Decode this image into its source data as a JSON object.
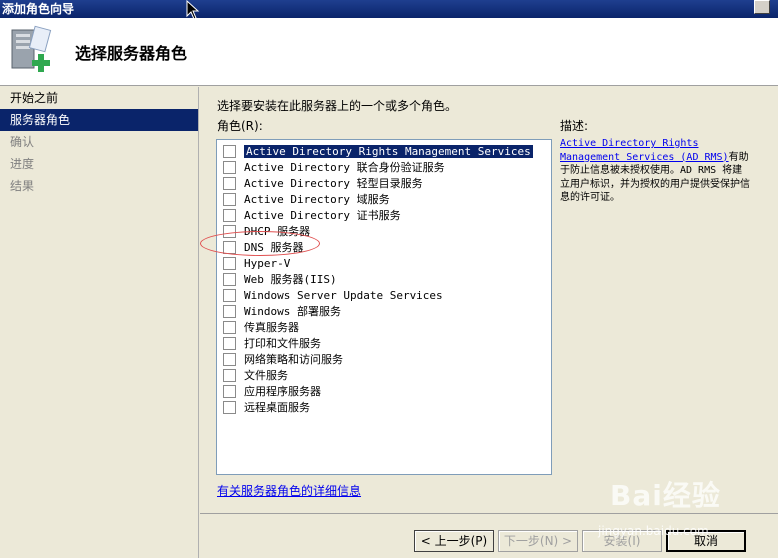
{
  "window": {
    "title": "添加角色向导"
  },
  "header": {
    "title": "选择服务器角色"
  },
  "nav": {
    "items": [
      {
        "label": "开始之前",
        "state": "done"
      },
      {
        "label": "服务器角色",
        "state": "active"
      },
      {
        "label": "确认",
        "state": "pending"
      },
      {
        "label": "进度",
        "state": "pending"
      },
      {
        "label": "结果",
        "state": "pending"
      }
    ]
  },
  "main": {
    "instruction": "选择要安装在此服务器上的一个或多个角色。",
    "roles_label": "角色(R):",
    "roles": [
      {
        "label": "Active Directory Rights Management Services",
        "checked": false,
        "selected": true
      },
      {
        "label": "Active Directory 联合身份验证服务",
        "checked": false
      },
      {
        "label": "Active Directory 轻型目录服务",
        "checked": false
      },
      {
        "label": "Active Directory 域服务",
        "checked": false
      },
      {
        "label": "Active Directory 证书服务",
        "checked": false
      },
      {
        "label": "DHCP 服务器",
        "checked": false
      },
      {
        "label": "DNS 服务器",
        "checked": false
      },
      {
        "label": "Hyper-V",
        "checked": false
      },
      {
        "label": "Web 服务器(IIS)",
        "checked": false
      },
      {
        "label": "Windows Server Update Services",
        "checked": false
      },
      {
        "label": "Windows 部署服务",
        "checked": false
      },
      {
        "label": "传真服务器",
        "checked": false
      },
      {
        "label": "打印和文件服务",
        "checked": false
      },
      {
        "label": "网络策略和访问服务",
        "checked": false
      },
      {
        "label": "文件服务",
        "checked": false
      },
      {
        "label": "应用程序服务器",
        "checked": false
      },
      {
        "label": "远程桌面服务",
        "checked": false
      }
    ],
    "description_label": "描述:",
    "description_link": "Active Directory Rights Management Services (AD RMS)",
    "description_text": "有助于防止信息被未授权使用。AD RMS 将建立用户标识，并为授权的用户提供受保护信息的许可证。",
    "more_info_link": "有关服务器角色的详细信息"
  },
  "footer": {
    "back_label": "< 上一步(P)",
    "next_label": "下一步(N) >",
    "install_label": "安装(I)",
    "cancel_label": "取消"
  },
  "watermark": {
    "brand": "Bai经验",
    "url": "jingyan.baidu.com"
  },
  "icons": {
    "header": "server-add-icon",
    "close": "close-icon"
  },
  "colors": {
    "title_bar": "#0a246a",
    "selection": "#0a246a",
    "link": "#0000ee",
    "annotation": "#e05050"
  }
}
